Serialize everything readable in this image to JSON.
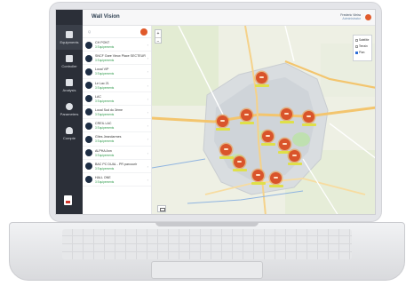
{
  "app": {
    "title": "Wall Vision",
    "user_name": "Frederic Vieira",
    "user_role": "Administrator"
  },
  "sidebar": {
    "logo": "",
    "items": [
      {
        "label": "Equipments",
        "icon": "building-icon"
      },
      {
        "label": "Controller",
        "icon": "monitor-icon"
      },
      {
        "label": "Analysis",
        "icon": "chart-icon"
      },
      {
        "label": "Parameters",
        "icon": "gear-icon"
      },
      {
        "label": "Compte",
        "icon": "user-icon"
      }
    ],
    "footer_small": ""
  },
  "list": {
    "search_placeholder": "Q",
    "rows": [
      {
        "name": "CH PONT",
        "sub": "3 Equipements"
      },
      {
        "name": "SNCF Gare Vieux Place SECTEUR",
        "sub": "3 Equipements"
      },
      {
        "name": "Local VIP",
        "sub": "3 Equipements"
      },
      {
        "name": "Le Lac 21",
        "sub": "3 Equipements"
      },
      {
        "name": "LAC",
        "sub": "3 Equipements"
      },
      {
        "name": "Local Sud du 3ème",
        "sub": "3 Equipements"
      },
      {
        "name": "CREIL LAC",
        "sub": "3 Equipements"
      },
      {
        "name": "Gîtes Jeandarmes",
        "sub": "3 Equipements"
      },
      {
        "name": "ALPHA Ann",
        "sub": "3 Equipements"
      },
      {
        "name": "BAC PC DUAL - PR parcourir",
        "sub": "3 Equipements"
      },
      {
        "name": "HALL ONE",
        "sub": "3 Equipements"
      }
    ]
  },
  "map": {
    "legend": [
      "Satellite",
      "Terrain",
      "Plan"
    ],
    "legend_selected": 2,
    "colors": {
      "marker": "#d9542b",
      "label": "#dfe04a",
      "road": "#f3c56e"
    }
  }
}
